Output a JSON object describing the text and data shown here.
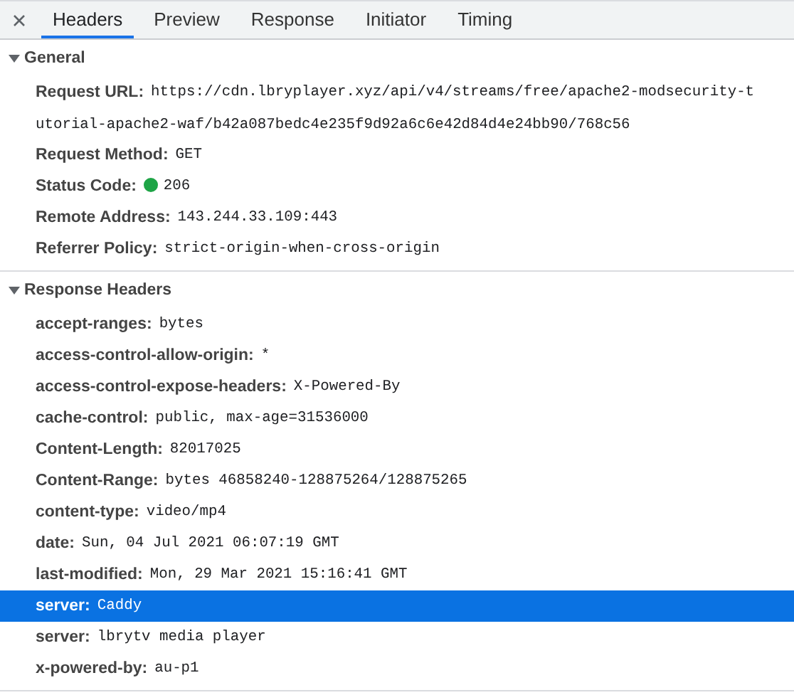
{
  "tabs": [
    {
      "label": "Headers",
      "selected": true
    },
    {
      "label": "Preview",
      "selected": false
    },
    {
      "label": "Response",
      "selected": false
    },
    {
      "label": "Initiator",
      "selected": false
    },
    {
      "label": "Timing",
      "selected": false
    }
  ],
  "sections": [
    {
      "title": "General",
      "expanded": true,
      "items": [
        {
          "name": "Request URL:",
          "value_lines": [
            "https://cdn.lbryplayer.xyz/api/v4/streams/free/apache2-modsecurity-t",
            "utorial-apache2-waf/b42a087bedc4e235f9d92a6c6e42d84d4e24bb90/768c56"
          ],
          "selected": false
        },
        {
          "name": "Request Method:",
          "value_lines": [
            "GET"
          ],
          "selected": false
        },
        {
          "name": "Status Code:",
          "value_lines": [
            "206"
          ],
          "color": "#1ea446",
          "selected": false
        },
        {
          "name": "Remote Address:",
          "value_lines": [
            "143.244.33.109:443"
          ],
          "selected": false
        },
        {
          "name": "Referrer Policy:",
          "value_lines": [
            "strict-origin-when-cross-origin"
          ],
          "selected": false
        }
      ]
    },
    {
      "title": "Response Headers",
      "expanded": true,
      "items": [
        {
          "name": "accept-ranges:",
          "value_lines": [
            "bytes"
          ],
          "selected": false
        },
        {
          "name": "access-control-allow-origin:",
          "value_lines": [
            "*"
          ],
          "selected": false
        },
        {
          "name": "access-control-expose-headers:",
          "value_lines": [
            "X-Powered-By"
          ],
          "selected": false
        },
        {
          "name": "cache-control:",
          "value_lines": [
            "public, max-age=31536000"
          ],
          "selected": false
        },
        {
          "name": "Content-Length:",
          "value_lines": [
            "82017025"
          ],
          "selected": false
        },
        {
          "name": "Content-Range:",
          "value_lines": [
            "bytes 46858240-128875264/128875265"
          ],
          "selected": false
        },
        {
          "name": "content-type:",
          "value_lines": [
            "video/mp4"
          ],
          "selected": false
        },
        {
          "name": "date:",
          "value_lines": [
            "Sun, 04 Jul 2021 06:07:19 GMT"
          ],
          "selected": false
        },
        {
          "name": "last-modified:",
          "value_lines": [
            "Mon, 29 Mar 2021 15:16:41 GMT"
          ],
          "selected": false
        },
        {
          "name": "server:",
          "value_lines": [
            "Caddy"
          ],
          "selected": true
        },
        {
          "name": "server:",
          "value_lines": [
            "lbrytv media player"
          ],
          "selected": false
        },
        {
          "name": "x-powered-by:",
          "value_lines": [
            "au-p1"
          ],
          "selected": false
        }
      ]
    }
  ]
}
